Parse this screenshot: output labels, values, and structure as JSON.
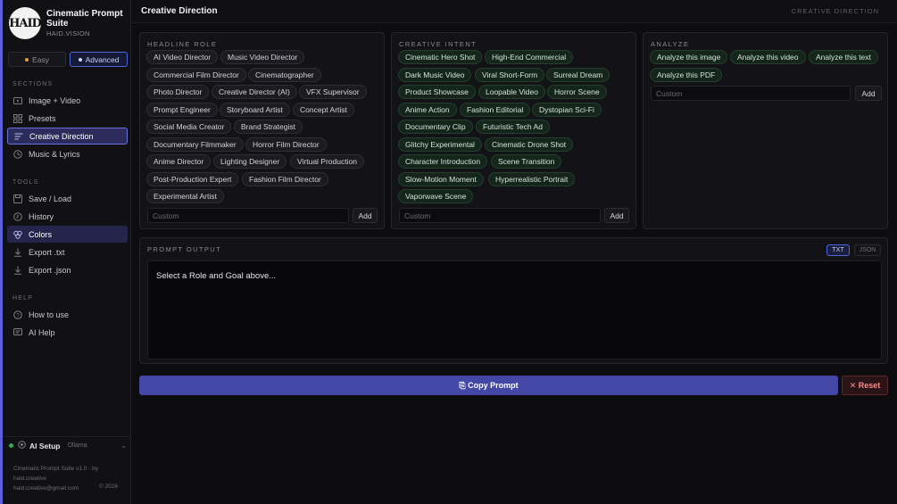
{
  "sidebar": {
    "logo_text": "HAID",
    "title": "Cinematic Prompt Suite",
    "subtitle": "HAID.VISION",
    "modes": [
      {
        "label": "Easy"
      },
      {
        "label": "Advanced"
      }
    ],
    "sections_label": "SECTIONS",
    "sections": [
      {
        "label": "Image + Video",
        "icon": "image-icon"
      },
      {
        "label": "Presets",
        "icon": "grid-icon"
      },
      {
        "label": "Creative Direction",
        "icon": "lines-icon"
      },
      {
        "label": "Music & Lyrics",
        "icon": "clock-icon"
      }
    ],
    "tools_label": "TOOLS",
    "tools": [
      {
        "label": "Save / Load",
        "icon": "save-icon"
      },
      {
        "label": "History",
        "icon": "history-icon"
      },
      {
        "label": "Colors",
        "icon": "palette-icon"
      },
      {
        "label": "Export .txt",
        "icon": "download-icon"
      },
      {
        "label": "Export .json",
        "icon": "download-icon"
      }
    ],
    "help_label": "HELP",
    "help": [
      {
        "label": "How to use",
        "icon": "question-icon"
      },
      {
        "label": "AI Help",
        "icon": "chat-icon"
      }
    ],
    "ai_setup": {
      "label": "AI Setup",
      "sub": "Ollama"
    },
    "footer": {
      "line1": "Cinematic Prompt Suite v1.0 · by haid.creative",
      "line2": "haid.creative@gmail.com",
      "year": "© 2026"
    }
  },
  "header": {
    "title": "Creative Direction",
    "crumb": "CREATIVE DIRECTION"
  },
  "headline_role": {
    "label": "HEADLINE ROLE",
    "chips": [
      "AI Video Director",
      "Music Video Director",
      "Commercial Film Director",
      "Cinematographer",
      "Photo Director",
      "Creative Director (AI)",
      "VFX Supervisor",
      "Prompt Engineer",
      "Storyboard Artist",
      "Concept Artist",
      "Social Media Creator",
      "Brand Strategist",
      "Documentary Filmmaker",
      "Horror Film Director",
      "Anime Director",
      "Lighting Designer",
      "Virtual Production",
      "Post-Production Expert",
      "Fashion Film Director",
      "Experimental Artist"
    ],
    "placeholder": "Custom",
    "add_label": "Add"
  },
  "creative_intent": {
    "label": "CREATIVE INTENT",
    "chips": [
      "Cinematic Hero Shot",
      "High-End Commercial",
      "Dark Music Video",
      "Viral Short-Form",
      "Surreal Dream",
      "Product Showcase",
      "Loopable Video",
      "Horror Scene",
      "Anime Action",
      "Fashion Editorial",
      "Dystopian Sci-Fi",
      "Documentary Clip",
      "Futuristic Tech Ad",
      "Glitchy Experimental",
      "Cinematic Drone Shot",
      "Character Introduction",
      "Scene Transition",
      "Slow-Motion Moment",
      "Hyperrealistic Portrait",
      "Vaporwave Scene"
    ],
    "placeholder": "Custom",
    "add_label": "Add"
  },
  "analyze": {
    "label": "ANALYZE",
    "chips": [
      "Analyze this image",
      "Analyze this video",
      "Analyze this text",
      "Analyze this PDF"
    ],
    "placeholder": "Custom",
    "add_label": "Add"
  },
  "prompt_output": {
    "label": "PROMPT OUTPUT",
    "formats": [
      "TXT",
      "JSON"
    ],
    "text": "Select a Role and Goal above..."
  },
  "actions": {
    "copy_label": "⎘ Copy Prompt",
    "reset_label": "✕ Reset"
  },
  "colors": {
    "accent": "#4447a6",
    "active_nav": "#2b2c5c",
    "intent_chip": "#15251c",
    "reset": "#ff8a8a"
  }
}
